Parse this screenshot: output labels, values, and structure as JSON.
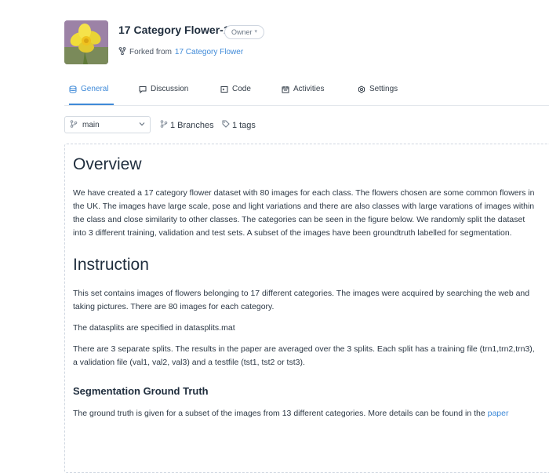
{
  "repo": {
    "title": "17 Category Flower-1",
    "owner_badge": "Owner",
    "forked_prefix": "Forked from",
    "forked_link": "17 Category Flower"
  },
  "tabs": [
    {
      "label": "General",
      "icon": "general-icon",
      "active": true
    },
    {
      "label": "Discussion",
      "icon": "discussion-icon"
    },
    {
      "label": "Code",
      "icon": "code-icon"
    },
    {
      "label": "Activities",
      "icon": "activities-icon"
    },
    {
      "label": "Settings",
      "icon": "settings-icon"
    }
  ],
  "branch": {
    "selected": "main",
    "branches_count": "1",
    "branches_label": "Branches",
    "tags_count": "1",
    "tags_label": "tags"
  },
  "readme": {
    "overview_heading": "Overview",
    "overview_text": "We have created a 17 category flower dataset with 80 images for each class. The flowers chosen are some common flowers in the UK. The images have large scale, pose and light variations and there are also classes with large varations of images within the class and close similarity to other classes. The categories can be seen in the figure below. We randomly split the dataset into 3 different training, validation and test sets. A subset of the images have been groundtruth labelled for segmentation.",
    "instruction_heading": "Instruction",
    "instruction_p1": "This set contains images of flowers belonging to 17 different categories. The images were acquired by searching the web and taking pictures. There are 80 images for each category.",
    "instruction_p2": "The datasplits are specified in datasplits.mat",
    "instruction_p3": "There are 3 separate splits. The results in the paper are averaged over the 3 splits. Each split has a training file (trn1,trn2,trn3), a validation file (val1, val2, val3) and a testfile (tst1, tst2 or tst3).",
    "segmentation_heading": "Segmentation Ground Truth",
    "segmentation_text": "The ground truth is given for a subset of the images from 13 different categories. More details can be found in the",
    "segmentation_link": "paper"
  },
  "colors": {
    "accent": "#3f8ad8",
    "text": "#2c3845",
    "border": "#e3e7ec"
  }
}
